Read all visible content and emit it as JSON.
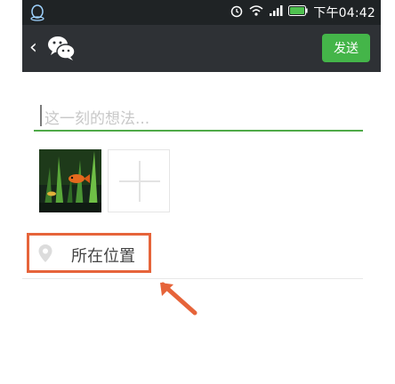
{
  "status_bar": {
    "time": "下午04:42",
    "icons": [
      "qq-icon",
      "alarm-icon",
      "wifi-icon",
      "signal-icon",
      "battery-icon"
    ]
  },
  "title_bar": {
    "send_label": "发送",
    "icons": [
      "back-chevron-icon",
      "wechat-logo-icon"
    ]
  },
  "composer": {
    "placeholder": "这一刻的想法..."
  },
  "photos": {
    "items": [
      "fish-aquarium-photo"
    ],
    "add_icon": "plus-icon"
  },
  "location": {
    "label": "所在位置",
    "icon": "location-pin-icon"
  },
  "annotation": {
    "highlight_color": "#e6643a",
    "arrow": "arrow-pointer-icon"
  }
}
